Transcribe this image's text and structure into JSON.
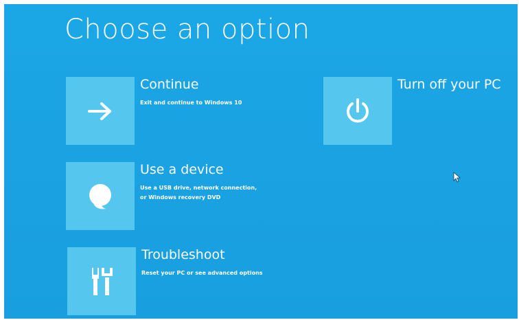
{
  "screen": {
    "title": "Choose an option",
    "background_color": "#1aa4e4",
    "tile_color": "#55c6ee"
  },
  "options": [
    {
      "label": "Continue",
      "description": "Exit and continue to Windows 10",
      "icon": "arrow-right-icon"
    },
    {
      "label": "Use a device",
      "description_line1": "Use a USB drive, network connection,",
      "description_line2": "or Windows recovery DVD",
      "icon": "device-icon"
    },
    {
      "label": "Troubleshoot",
      "description": "Reset your PC or see advanced options",
      "icon": "tools-icon"
    },
    {
      "label": "Turn off your PC",
      "icon": "power-icon"
    }
  ]
}
